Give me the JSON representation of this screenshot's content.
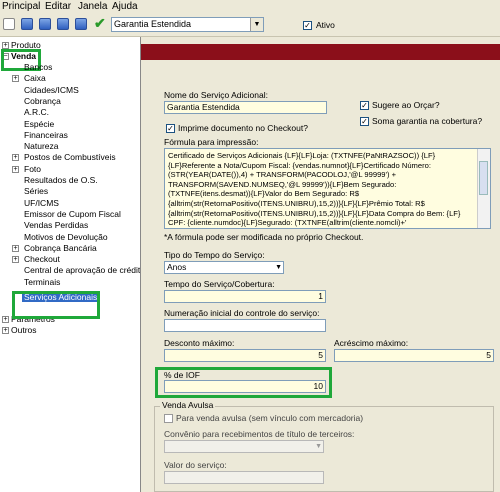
{
  "menu": [
    "Principal",
    "Editar",
    "Janela",
    "Ajuda"
  ],
  "toolbar": {
    "combo_value": "Garantia Estendida",
    "ativo_label": "Ativo",
    "ativo_checked": true
  },
  "tree": {
    "produto": "Produto",
    "venda": "Venda",
    "items": [
      "Bancos",
      "Caixa",
      "Cidades/ICMS",
      "Cobrança",
      "A.R.C.",
      "Espécie",
      "Financeiras",
      "Natureza",
      "Postos de Combustíveis",
      "Foto",
      "Resultados de O.S.",
      "Séries",
      "UF/ICMS",
      "Emissor de Cupom Fiscal",
      "Vendas Perdidas",
      "Motivos de Devolução",
      "Cobrança Bancária",
      "Checkout",
      "Central de aprovação de crédito",
      "Terminais",
      "Serviços Adicionais"
    ],
    "after": [
      "Parâmetros",
      "Outros"
    ]
  },
  "form": {
    "nome_label": "Nome do Serviço Adicional:",
    "nome_value": "Garantia Estendida",
    "sugere_label": "Sugere ao Orçar?",
    "soma_label": "Soma garantia na cobertura?",
    "imprime_label": "Imprime documento no Checkout?",
    "formula_label": "Fórmula para impressão:",
    "formula_text": "Certificado de Serviços Adicionais {LF}{LF}Loja: (TXTNFE(PaNtRAZSOC)) {LF}{LF}Referente a Nota/Cupom Fiscal: {vendas.numnot}{LF}Certificado Número: (STR(YEAR(DATE()),4) + TRANSFORM(PACODLOJ,'@L 99999') + TRANSFORM(SAVEND.NUMSEQ,'@L 99999')){LF}Bem Segurado: (TXTNFE(itens.desmat)){LF}Valor do Bem Segurado: R$ {alltrim(str(RetornaPositivo(ITENS.UNIBRU),15,2))}{LF}{LF}Prêmio Total: R$ {alltrim(str(RetornaPositivo(ITENS.UNIBRU),15,2))}{LF}{LF}Data Compra do Bem: {LF} CPF: {cliente.numdoc}{LF}Segurado: (TXTNFE(alltrim(cliente.nomcli)+'",
    "formula_note": "*A fórmula pode ser modificada no próprio Checkout.",
    "tipo_label": "Tipo do Tempo do Serviço:",
    "tipo_value": "Anos",
    "tempo_label": "Tempo do Serviço/Cobertura:",
    "tempo_value": "1",
    "numeracao_label": "Numeração inicial do controle do serviço:",
    "numeracao_value": "",
    "desconto_label": "Desconto máximo:",
    "desconto_value": "5",
    "acrescimo_label": "Acréscimo máximo:",
    "acrescimo_value": "5",
    "iof_label": "% de IOF",
    "iof_value": "10",
    "avulsa_title": "Venda Avulsa",
    "avulsa_check_label": "Para venda avulsa (sem vínculo com mercadoria)",
    "convenio_label": "Convênio para recebimentos de título de terceiros:",
    "valor_label": "Valor do serviço:"
  },
  "colors": {
    "accent_red": "#8b0f1a",
    "highlight_green": "#1fa83a",
    "selection_blue": "#316ac5"
  }
}
